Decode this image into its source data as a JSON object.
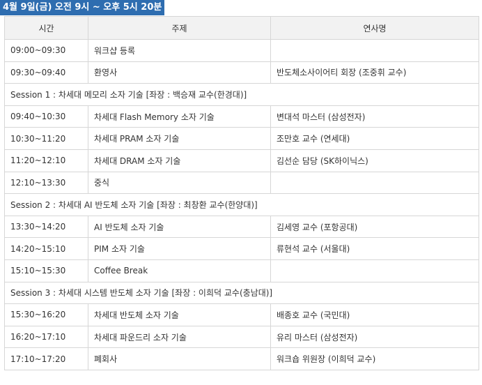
{
  "title": "4월 9일(금)  오전 9시 ~ 오후 5시 20분",
  "headers": {
    "time": "시간",
    "topic": "주제",
    "speaker": "연사명"
  },
  "rows": [
    {
      "type": "item",
      "time": "09:00~09:30",
      "topic": "워크샵 등록",
      "speaker": ""
    },
    {
      "type": "item",
      "time": "09:30~09:40",
      "topic": "환영사",
      "speaker": "반도체소사이어티 회장 (조중휘 교수)"
    },
    {
      "type": "session",
      "label": "Session 1 : 차세대 메모리 소자 기술 [좌장 : 백승재 교수(한경대)]"
    },
    {
      "type": "item",
      "time": "09:40~10:30",
      "topic": "차세대 Flash Memory 소자 기술",
      "speaker": "변대석 마스터 (삼성전자)"
    },
    {
      "type": "item",
      "time": "10:30~11:20",
      "topic": "차세대 PRAM 소자 기술",
      "speaker": "조만호 교수 (연세대)"
    },
    {
      "type": "item",
      "time": "11:20~12:10",
      "topic": "차세대 DRAM 소자 기술",
      "speaker": "김선순 담당 (SK하이닉스)"
    },
    {
      "type": "item",
      "time": "12:10~13:30",
      "topic": "중식",
      "speaker": ""
    },
    {
      "type": "session",
      "label": "Session 2 : 차세대 AI 반도체 소자 기술 [좌장 : 최창환 교수(한양대)]"
    },
    {
      "type": "item",
      "time": "13:30~14:20",
      "topic": "AI 반도체 소자 기술",
      "speaker": "김세영 교수 (포항공대)"
    },
    {
      "type": "item",
      "time": "14:20~15:10",
      "topic": "PIM 소자 기술",
      "speaker": "류현석 교수 (서울대)"
    },
    {
      "type": "item",
      "time": "15:10~15:30",
      "topic": "Coffee Break",
      "speaker": ""
    },
    {
      "type": "session",
      "label": "Session 3 : 차세대 시스템 반도체 소자 기술 [좌장 : 이희덕 교수(충남대)]"
    },
    {
      "type": "item",
      "time": "15:30~16:20",
      "topic": "차세대 반도체 소자 기술",
      "speaker": "배종호 교수 (국민대)"
    },
    {
      "type": "item",
      "time": "16:20~17:10",
      "topic": "차세대 파운드리 소자 기술",
      "speaker": "유리 마스터 (삼성전자)"
    },
    {
      "type": "item",
      "time": "17:10~17:20",
      "topic": "폐회사",
      "speaker": "워크숍 위원장 (이희덕 교수)"
    }
  ]
}
